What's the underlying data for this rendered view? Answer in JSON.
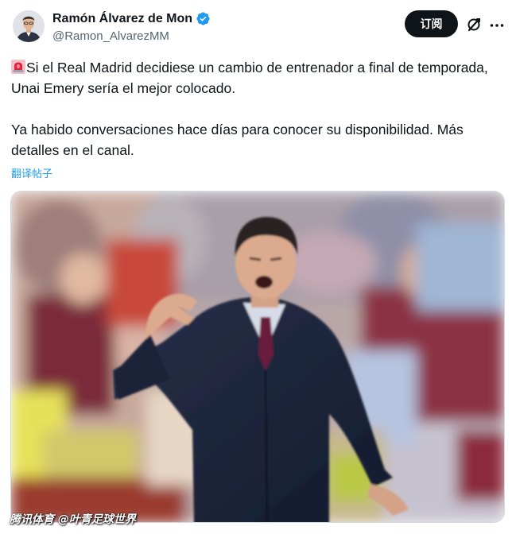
{
  "author": {
    "display_name": "Ramón Álvarez de Mon",
    "handle": "@Ramon_AlvarezMM",
    "verified": true,
    "verified_color": "#1d9bf0"
  },
  "actions": {
    "subscribe_label": "订阅",
    "grok_icon": "grok-icon",
    "more_icon": "more-icon"
  },
  "tweet": {
    "emoji": "rotating-light",
    "line1": "Si el Real Madrid decidiese un cambio de entrenador a final de temporada, Unai Emery sería el mejor colocado.",
    "line2": "Ya habido conversaciones hace días para conocer su disponibilidad. Más detalles en el canal.",
    "translate_label": "翻译帖子"
  },
  "media": {
    "watermark": "腾讯体育 @叶青足球世界"
  },
  "colors": {
    "text": "#0f1419",
    "secondary": "#536471",
    "link": "#1d9bf0",
    "button": "#0f1419"
  }
}
